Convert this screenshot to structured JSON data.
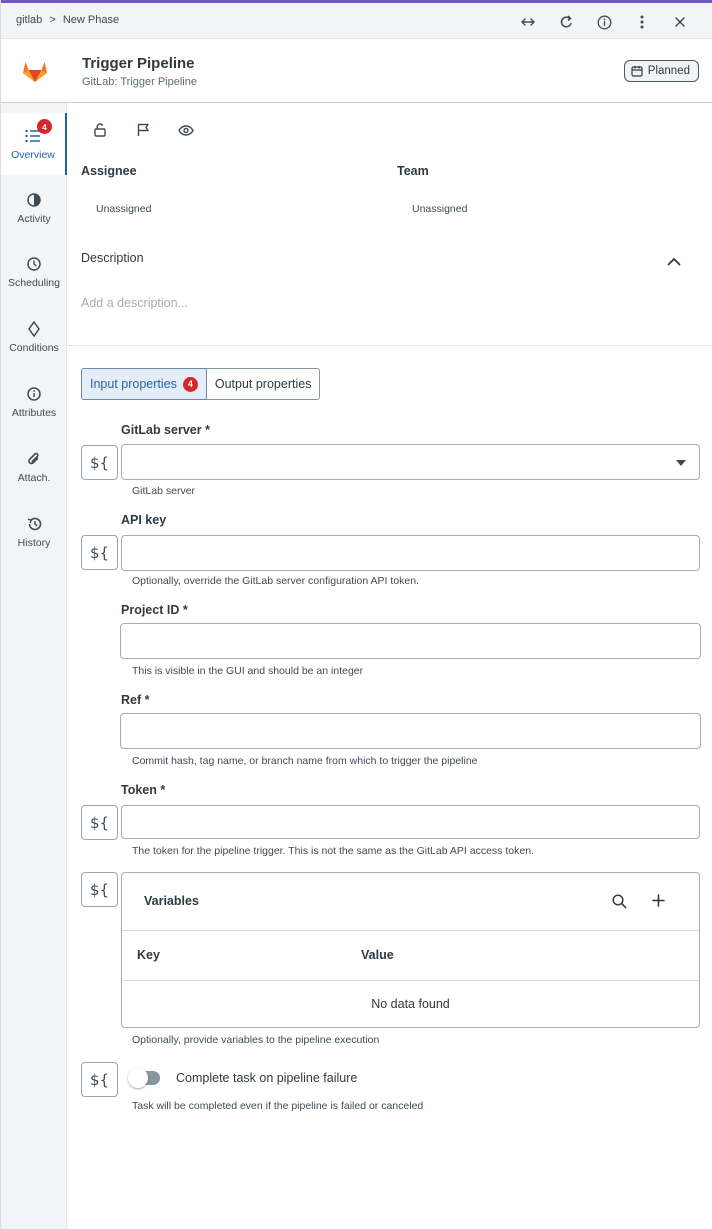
{
  "topbar": {
    "breadcrumb": [
      "gitlab",
      ">",
      "New Phase"
    ],
    "accent_color": "#6e57c6",
    "icons": [
      "expand-horizontal-icon",
      "refresh-icon",
      "info-icon",
      "more-vertical-icon",
      "close-icon"
    ]
  },
  "header": {
    "title": "Trigger Pipeline",
    "subtitle": "GitLab: Trigger Pipeline",
    "status": "Planned"
  },
  "nav": {
    "items": [
      {
        "label": "Overview",
        "badge": "4",
        "icon": "list-icon"
      },
      {
        "label": "Activity",
        "icon": "pie-icon"
      },
      {
        "label": "Scheduling",
        "icon": "clock-icon"
      },
      {
        "label": "Conditions",
        "icon": "diamond-icon"
      },
      {
        "label": "Attributes",
        "icon": "info-icon"
      },
      {
        "label": "Attach.",
        "icon": "paperclip-icon"
      },
      {
        "label": "History",
        "icon": "history-icon"
      }
    ]
  },
  "overview": {
    "assignee_label": "Assignee",
    "assignee_value": "Unassigned",
    "team_label": "Team",
    "team_value": "Unassigned",
    "description_label": "Description",
    "description_placeholder": "Add a description..."
  },
  "tabs": {
    "input": "Input properties",
    "input_badge": "4",
    "output": "Output properties"
  },
  "form": {
    "expr_symbol": "${",
    "gitlab_server": {
      "label": "GitLab server *",
      "hint": "GitLab server"
    },
    "api_key": {
      "label": "API key",
      "hint": "Optionally, override the GitLab server configuration API token."
    },
    "project_id": {
      "label": "Project ID *",
      "hint": "This is visible in the GUI and should be an integer"
    },
    "ref": {
      "label": "Ref *",
      "hint": "Commit hash, tag name, or branch name from which to trigger the pipeline"
    },
    "token": {
      "label": "Token *",
      "hint": "The token for the pipeline trigger. This is not the same as the GitLab API access token."
    },
    "variables": {
      "title": "Variables",
      "col_key": "Key",
      "col_value": "Value",
      "empty": "No data found",
      "hint": "Optionally, provide variables to the pipeline execution"
    },
    "complete_on_failure": {
      "label": "Complete task on pipeline failure",
      "hint": "Task will be completed even if the pipeline is failed or canceled",
      "checked": false
    }
  },
  "colors": {
    "badge": "#d62828",
    "active": "#2563a8",
    "logo_orange": "#e24329"
  }
}
